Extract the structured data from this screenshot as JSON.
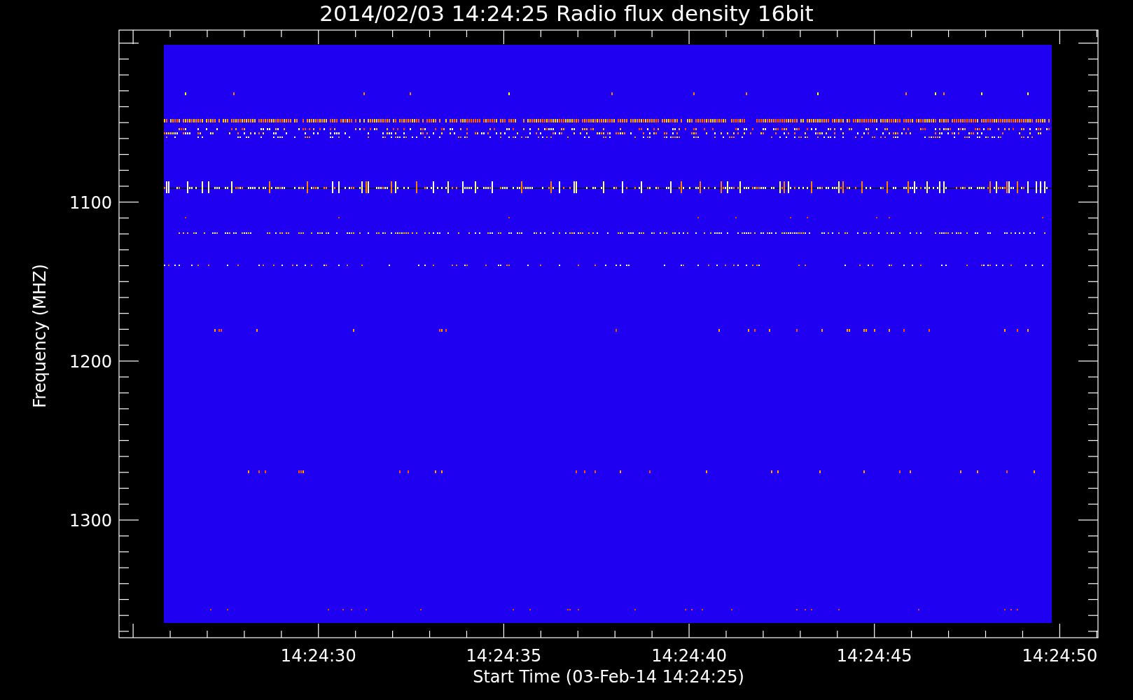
{
  "plot": {
    "title": "2014/02/03 14:24:25 Radio flux density 16bit",
    "xlabel": "Start Time (03-Feb-14 14:24:25)",
    "ylabel": "Frequency (MHZ)",
    "x_tick_labels": [
      "14:24:30",
      "14:24:35",
      "14:24:40",
      "14:24:45",
      "14:24:50"
    ],
    "y_tick_labels": [
      "1100",
      "1200",
      "1300"
    ]
  }
}
